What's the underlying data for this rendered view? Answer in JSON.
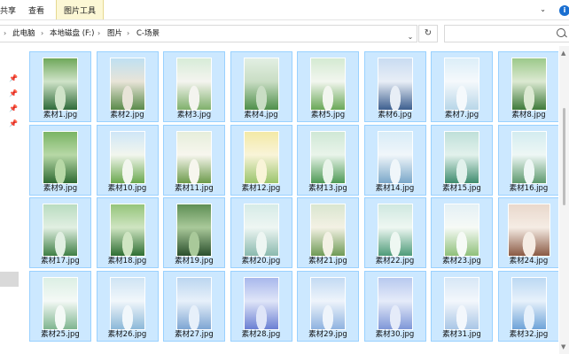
{
  "ribbon": {
    "tabs": [
      "共享",
      "查看",
      "图片工具"
    ],
    "help_glyph": "i"
  },
  "address": {
    "crumbs": [
      "此电脑",
      "本地磁盘 (F:)",
      "图片",
      "C-场景"
    ]
  },
  "files": [
    {
      "name": "素材1.jpg",
      "colors": [
        "#6fa85a",
        "#2f6b3a",
        "#cfe3c8"
      ]
    },
    {
      "name": "素材2.jpg",
      "colors": [
        "#bfe0f2",
        "#5a8a4a",
        "#e8e4d8"
      ]
    },
    {
      "name": "素材3.jpg",
      "colors": [
        "#d7ecd8",
        "#7fb06c",
        "#f4f4ef"
      ]
    },
    {
      "name": "素材4.jpg",
      "colors": [
        "#e2efe3",
        "#4f8f4a",
        "#c9ddc4"
      ]
    },
    {
      "name": "素材5.jpg",
      "colors": [
        "#d4ead2",
        "#6aa858",
        "#f2f6ef"
      ]
    },
    {
      "name": "素材6.jpg",
      "colors": [
        "#c9dcf2",
        "#3d5f8f",
        "#e8eef6"
      ]
    },
    {
      "name": "素材7.jpg",
      "colors": [
        "#dceef8",
        "#b8d6e8",
        "#f5f9fc"
      ]
    },
    {
      "name": "素材8.jpg",
      "colors": [
        "#9cc98a",
        "#3f7a3a",
        "#dce9d2"
      ]
    },
    {
      "name": "素材9.jpg",
      "colors": [
        "#7ab464",
        "#2f6a33",
        "#b7d8a6"
      ]
    },
    {
      "name": "素材10.jpg",
      "colors": [
        "#cfe6f7",
        "#6aa84f",
        "#f2f6ee"
      ]
    },
    {
      "name": "素材11.jpg",
      "colors": [
        "#e6eedb",
        "#6d9b4c",
        "#f7f6ee"
      ]
    },
    {
      "name": "素材12.jpg",
      "colors": [
        "#f3e9a6",
        "#9ac46c",
        "#f9f4d8"
      ]
    },
    {
      "name": "素材13.jpg",
      "colors": [
        "#cfe8d6",
        "#4f9a56",
        "#e9f4ea"
      ]
    },
    {
      "name": "素材14.jpg",
      "colors": [
        "#d8ecf7",
        "#7aa7c9",
        "#f0f6fa"
      ]
    },
    {
      "name": "素材15.jpg",
      "colors": [
        "#bfe0d9",
        "#3f8c6e",
        "#e2f1ec"
      ]
    },
    {
      "name": "素材16.jpg",
      "colors": [
        "#d3ecf0",
        "#5f9a6f",
        "#eef7f5"
      ]
    },
    {
      "name": "素材17.jpg",
      "colors": [
        "#b9dcc0",
        "#3f7f45",
        "#e1efe2"
      ]
    },
    {
      "name": "素材18.jpg",
      "colors": [
        "#95c47a",
        "#2f6e33",
        "#cfe5c2"
      ]
    },
    {
      "name": "素材19.jpg",
      "colors": [
        "#5f8f55",
        "#2b4f2c",
        "#a9c99a"
      ]
    },
    {
      "name": "素材20.jpg",
      "colors": [
        "#d6ebe7",
        "#8ab9ae",
        "#eef6f3"
      ]
    },
    {
      "name": "素材21.jpg",
      "colors": [
        "#d9e6d0",
        "#6f9a56",
        "#f3f1e4"
      ]
    },
    {
      "name": "素材22.jpg",
      "colors": [
        "#cfe8e0",
        "#4f9b79",
        "#eef7f2"
      ]
    },
    {
      "name": "素材23.jpg",
      "colors": [
        "#e4f0f5",
        "#8fc07a",
        "#f6faf6"
      ]
    },
    {
      "name": "素材24.jpg",
      "colors": [
        "#e9d8cc",
        "#8a5a44",
        "#f5ece4"
      ]
    },
    {
      "name": "素材25.jpg",
      "colors": [
        "#dcefe4",
        "#7fb58f",
        "#f4f9f6"
      ]
    },
    {
      "name": "素材26.jpg",
      "colors": [
        "#cfe4f4",
        "#8cb8d8",
        "#f1f7fb"
      ]
    },
    {
      "name": "素材27.jpg",
      "colors": [
        "#bcd6f0",
        "#7ea6d3",
        "#e7f0fa"
      ]
    },
    {
      "name": "素材28.jpg",
      "colors": [
        "#a9b8ec",
        "#6b7fd3",
        "#dfe5f8"
      ]
    },
    {
      "name": "素材29.jpg",
      "colors": [
        "#c3daf3",
        "#8fb3e0",
        "#eef4fb"
      ]
    },
    {
      "name": "素材30.jpg",
      "colors": [
        "#b8c9ef",
        "#7f97d8",
        "#e5ebf9"
      ]
    },
    {
      "name": "素材31.jpg",
      "colors": [
        "#d7e7f6",
        "#a9c6e6",
        "#f3f7fc"
      ]
    },
    {
      "name": "素材32.jpg",
      "colors": [
        "#bcd9f3",
        "#6ea3d8",
        "#e7f1fb"
      ]
    }
  ]
}
